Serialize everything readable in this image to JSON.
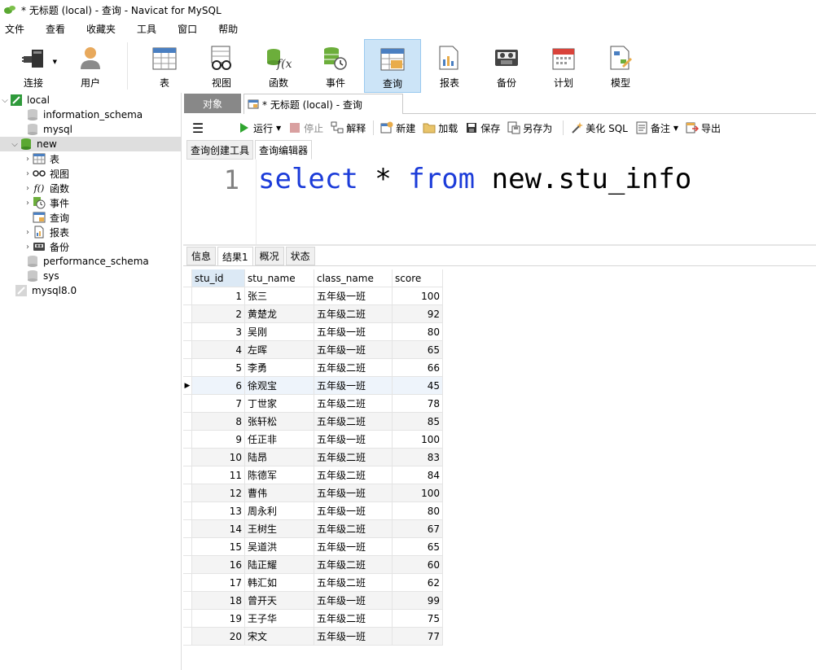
{
  "window": {
    "title": "* 无标题 (local) - 查询 - Navicat for MySQL"
  },
  "menu": [
    "文件",
    "查看",
    "收藏夹",
    "工具",
    "窗口",
    "帮助"
  ],
  "toolbar": [
    {
      "label": "连接",
      "icon": "plug-icon"
    },
    {
      "label": "用户",
      "icon": "user-icon"
    },
    {
      "label": "表",
      "icon": "table-icon"
    },
    {
      "label": "视图",
      "icon": "view-glasses-icon"
    },
    {
      "label": "函数",
      "icon": "function-icon"
    },
    {
      "label": "事件",
      "icon": "event-icon"
    },
    {
      "label": "查询",
      "icon": "query-icon",
      "active": true
    },
    {
      "label": "报表",
      "icon": "report-icon"
    },
    {
      "label": "备份",
      "icon": "backup-icon"
    },
    {
      "label": "计划",
      "icon": "calendar-icon"
    },
    {
      "label": "模型",
      "icon": "model-icon"
    }
  ],
  "nav": {
    "local": "local",
    "information_schema": "information_schema",
    "mysql": "mysql",
    "new": "new",
    "new_children": [
      "表",
      "视图",
      "函数",
      "事件",
      "查询",
      "报表",
      "备份"
    ],
    "performance_schema": "performance_schema",
    "sys": "sys",
    "mysql8": "mysql8.0"
  },
  "tabs": {
    "objects": "对象",
    "query": "* 无标题 (local) - 查询"
  },
  "query_toolbar": {
    "run": "运行",
    "stop": "停止",
    "explain": "解释",
    "new": "新建",
    "load": "加载",
    "save": "保存",
    "save_as": "另存为",
    "beautify": "美化 SQL",
    "comment": "备注",
    "export": "导出"
  },
  "subtabs": {
    "builder": "查询创建工具",
    "editor": "查询编辑器"
  },
  "editor": {
    "line_number": "1",
    "kw_select": "select",
    "star": " * ",
    "kw_from": "from",
    "rest": " new.stu_info"
  },
  "result_tabs": [
    "信息",
    "结果1",
    "概况",
    "状态"
  ],
  "grid": {
    "columns": [
      "stu_id",
      "stu_name",
      "class_name",
      "score"
    ],
    "rows": [
      [
        "1",
        "张三",
        "五年级一班",
        "100"
      ],
      [
        "2",
        "黄楚龙",
        "五年级二班",
        "92"
      ],
      [
        "3",
        "吴刚",
        "五年级一班",
        "80"
      ],
      [
        "4",
        "左晖",
        "五年级一班",
        "65"
      ],
      [
        "5",
        "李勇",
        "五年级二班",
        "66"
      ],
      [
        "6",
        "徐观宝",
        "五年级一班",
        "45"
      ],
      [
        "7",
        "丁世家",
        "五年级二班",
        "78"
      ],
      [
        "8",
        "张轩松",
        "五年级二班",
        "85"
      ],
      [
        "9",
        "任正非",
        "五年级一班",
        "100"
      ],
      [
        "10",
        "陆昂",
        "五年级二班",
        "83"
      ],
      [
        "11",
        "陈德军",
        "五年级二班",
        "84"
      ],
      [
        "12",
        "曹伟",
        "五年级一班",
        "100"
      ],
      [
        "13",
        "周永利",
        "五年级一班",
        "80"
      ],
      [
        "14",
        "王树生",
        "五年级二班",
        "67"
      ],
      [
        "15",
        "吴道洪",
        "五年级一班",
        "65"
      ],
      [
        "16",
        "陆正耀",
        "五年级二班",
        "60"
      ],
      [
        "17",
        "韩汇如",
        "五年级二班",
        "62"
      ],
      [
        "18",
        "曾开天",
        "五年级一班",
        "99"
      ],
      [
        "19",
        "王子华",
        "五年级二班",
        "75"
      ],
      [
        "20",
        "宋文",
        "五年级一班",
        "77"
      ]
    ],
    "current_row": 6
  },
  "colors": {
    "accent": "#cce4f7",
    "keyword": "#1c3cd9",
    "run_green": "#2fa52f"
  }
}
